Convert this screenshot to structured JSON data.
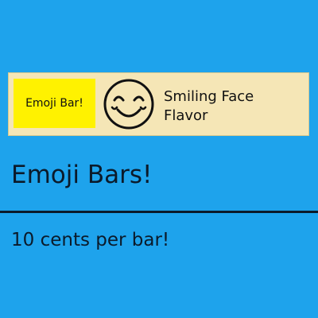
{
  "product_card": {
    "label": "Emoji Bar!",
    "icon": "smiling-face-icon",
    "flavor_line1": "Smiling Face",
    "flavor_line2": "Flavor"
  },
  "heading": "Emoji Bars!",
  "price": "10 cents per bar!",
  "colors": {
    "background": "#1ea3ec",
    "card": "#f5e6b6",
    "label": "#fff200"
  }
}
